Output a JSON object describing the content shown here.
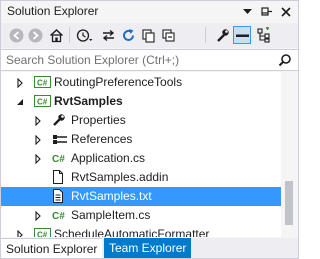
{
  "window": {
    "title": "Solution Explorer",
    "controls": [
      "dropdown",
      "pin",
      "close"
    ]
  },
  "toolbar": {
    "buttons": [
      "back",
      "forward",
      "home",
      "history",
      "sync",
      "refresh",
      "copy",
      "collapse-all",
      "properties",
      "show-all-files",
      "preview"
    ]
  },
  "search": {
    "placeholder": "Search Solution Explorer (Ctrl+;)"
  },
  "tree": {
    "items": [
      {
        "label": "RoutingPreferenceTools",
        "icon": "csproj-icon",
        "expander": "collapsed",
        "bold": false,
        "selected": false
      },
      {
        "label": "RvtSamples",
        "icon": "csproj-icon",
        "expander": "expanded",
        "bold": true,
        "selected": false
      },
      {
        "label": "Properties",
        "icon": "wrench-icon",
        "expander": "collapsed",
        "bold": false,
        "selected": false
      },
      {
        "label": "References",
        "icon": "references-icon",
        "expander": "collapsed",
        "bold": false,
        "selected": false
      },
      {
        "label": "Application.cs",
        "icon": "csharp-file-icon",
        "expander": "collapsed",
        "bold": false,
        "selected": false
      },
      {
        "label": "RvtSamples.addin",
        "icon": "file-icon",
        "expander": "none",
        "bold": false,
        "selected": false
      },
      {
        "label": "RvtSamples.txt",
        "icon": "text-file-icon",
        "expander": "none",
        "bold": false,
        "selected": true
      },
      {
        "label": "SampleItem.cs",
        "icon": "csharp-file-icon",
        "expander": "collapsed",
        "bold": false,
        "selected": false
      },
      {
        "label": "ScheduleAutomaticFormatter",
        "icon": "csproj-icon",
        "expander": "collapsed",
        "bold": false,
        "selected": false
      }
    ]
  },
  "tabs": [
    {
      "label": "Solution Explorer",
      "active": true
    },
    {
      "label": "Team Explorer",
      "active": false
    }
  ],
  "colors": {
    "selection": "#3399ff",
    "tab_inactive": "#007acc",
    "csharp_green": "#388a34"
  }
}
